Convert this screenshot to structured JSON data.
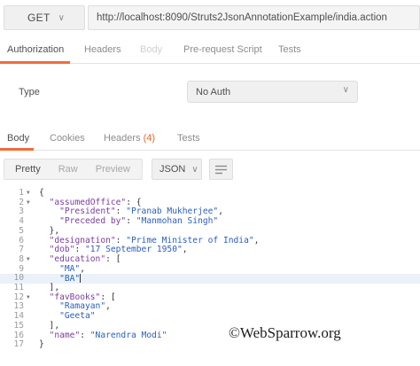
{
  "request": {
    "method": "GET",
    "url": "http://localhost:8090/Struts2JsonAnnotationExample/india.action"
  },
  "request_tabs": [
    {
      "label": "Authorization",
      "state": "active"
    },
    {
      "label": "Headers",
      "state": "normal"
    },
    {
      "label": "Body",
      "state": "disabled"
    },
    {
      "label": "Pre-request Script",
      "state": "normal"
    },
    {
      "label": "Tests",
      "state": "normal"
    }
  ],
  "auth": {
    "type_label": "Type",
    "selected": "No Auth"
  },
  "response_tabs": {
    "body": "Body",
    "cookies": "Cookies",
    "headers": "Headers",
    "headers_count": "(4)",
    "tests": "Tests"
  },
  "viewer": {
    "modes": [
      "Pretty",
      "Raw",
      "Preview"
    ],
    "format": "JSON"
  },
  "code_lines": [
    {
      "n": "1",
      "fold": true,
      "parts": [
        [
          "p",
          "{"
        ]
      ]
    },
    {
      "n": "2",
      "fold": true,
      "parts": [
        [
          "p",
          "  "
        ],
        [
          "k",
          "\"assumedOffice\""
        ],
        [
          "p",
          ": {"
        ]
      ]
    },
    {
      "n": "3",
      "parts": [
        [
          "p",
          "    "
        ],
        [
          "k",
          "\"President\""
        ],
        [
          "p",
          ": "
        ],
        [
          "s",
          "\"Pranab Mukherjee\""
        ],
        [
          "p",
          ","
        ]
      ]
    },
    {
      "n": "4",
      "parts": [
        [
          "p",
          "    "
        ],
        [
          "k",
          "\"Preceded by\""
        ],
        [
          "p",
          ": "
        ],
        [
          "s",
          "\"Manmohan Singh\""
        ]
      ]
    },
    {
      "n": "5",
      "parts": [
        [
          "p",
          "  },"
        ]
      ]
    },
    {
      "n": "6",
      "parts": [
        [
          "p",
          "  "
        ],
        [
          "k",
          "\"designation\""
        ],
        [
          "p",
          ": "
        ],
        [
          "s",
          "\"Prime Minister of India\""
        ],
        [
          "p",
          ","
        ]
      ]
    },
    {
      "n": "7",
      "parts": [
        [
          "p",
          "  "
        ],
        [
          "k",
          "\"dob\""
        ],
        [
          "p",
          ": "
        ],
        [
          "s",
          "\"17 September 1950\""
        ],
        [
          "p",
          ","
        ]
      ]
    },
    {
      "n": "8",
      "fold": true,
      "parts": [
        [
          "p",
          "  "
        ],
        [
          "k",
          "\"education\""
        ],
        [
          "p",
          ": ["
        ]
      ]
    },
    {
      "n": "9",
      "parts": [
        [
          "p",
          "    "
        ],
        [
          "s",
          "\"MA\""
        ],
        [
          "p",
          ","
        ]
      ]
    },
    {
      "n": "10",
      "highlight": true,
      "parts": [
        [
          "p",
          "    "
        ],
        [
          "s",
          "\"BA\""
        ]
      ]
    },
    {
      "n": "11",
      "parts": [
        [
          "p",
          "  ],"
        ]
      ]
    },
    {
      "n": "12",
      "fold": true,
      "parts": [
        [
          "p",
          "  "
        ],
        [
          "k",
          "\"favBooks\""
        ],
        [
          "p",
          ": ["
        ]
      ]
    },
    {
      "n": "13",
      "parts": [
        [
          "p",
          "    "
        ],
        [
          "s",
          "\"Ramayan\""
        ],
        [
          "p",
          ","
        ]
      ]
    },
    {
      "n": "14",
      "parts": [
        [
          "p",
          "    "
        ],
        [
          "s",
          "\"Geeta\""
        ]
      ]
    },
    {
      "n": "15",
      "parts": [
        [
          "p",
          "  ],"
        ]
      ]
    },
    {
      "n": "16",
      "parts": [
        [
          "p",
          "  "
        ],
        [
          "k",
          "\"name\""
        ],
        [
          "p",
          ": "
        ],
        [
          "s",
          "\"Narendra Modi\""
        ]
      ]
    },
    {
      "n": "17",
      "parts": [
        [
          "p",
          "}"
        ]
      ]
    }
  ],
  "watermark": "©WebSparrow.org",
  "colors": {
    "accent": "#f26b3a",
    "json_key": "#7a3e9d",
    "json_string": "#2b5fb8",
    "line_highlight": "#eaf1f9"
  }
}
